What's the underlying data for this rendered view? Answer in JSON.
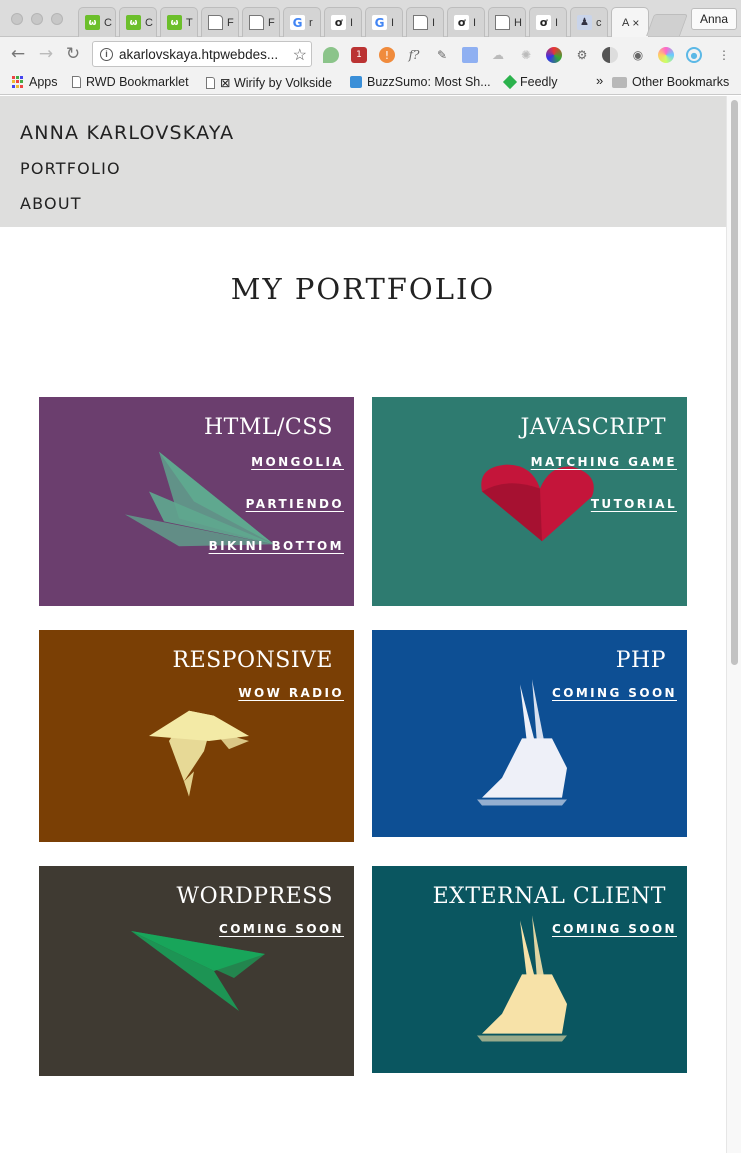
{
  "browser": {
    "tabs": [
      {
        "title": "C",
        "icon": "green"
      },
      {
        "title": "C",
        "icon": "green"
      },
      {
        "title": "T",
        "icon": "green"
      },
      {
        "title": "F",
        "icon": "doc"
      },
      {
        "title": "F",
        "icon": "doc"
      },
      {
        "title": "r",
        "icon": "goog"
      },
      {
        "title": "I",
        "icon": "cp"
      },
      {
        "title": "I",
        "icon": "goog"
      },
      {
        "title": "I",
        "icon": "doc"
      },
      {
        "title": "I",
        "icon": "cp"
      },
      {
        "title": "H",
        "icon": "doc"
      },
      {
        "title": "I",
        "icon": "cp"
      },
      {
        "title": "c",
        "icon": "user"
      },
      {
        "title": "A",
        "icon": "none"
      }
    ],
    "profile_name": "Anna",
    "url": "akarlovskaya.htpwebdes...",
    "bookmarks": {
      "apps": "Apps",
      "rwd": "RWD Bookmarklet",
      "wirify": "⊠ Wirify by Volkside",
      "buzzsumo": "BuzzSumo: Most Sh...",
      "feedly": "Feedly",
      "overflow": "»",
      "other": "Other Bookmarks"
    }
  },
  "site": {
    "name": "ANNA KARLOVSKAYA",
    "nav": [
      "PORTFOLIO",
      "ABOUT"
    ],
    "page_title": "MY PORTFOLIO"
  },
  "cards": [
    {
      "title": "HTML/CSS",
      "links": [
        "MONGOLIA",
        "PARTIENDO",
        "BIKINI BOTTOM"
      ],
      "bg": "#6b3e6e",
      "art": "plane",
      "art_color": "#5fa88f"
    },
    {
      "title": "JAVASCRIPT",
      "links": [
        "MATCHING GAME",
        "TUTORIAL"
      ],
      "bg": "#2e7b70",
      "art": "heart",
      "art_color": "#c4153a"
    },
    {
      "title": "RESPONSIVE",
      "links": [
        "WOW RADIO"
      ],
      "bg": "#7a3f05",
      "art": "bird",
      "art_color": "#f3eaa6"
    },
    {
      "title": "PHP",
      "links": [
        "COMING SOON"
      ],
      "bg": "#0d4f94",
      "art": "rabbit",
      "art_color": "#eef0f8"
    },
    {
      "title": "WORDPRESS",
      "links": [
        "COMING SOON"
      ],
      "bg": "#3f3a32",
      "art": "plane2",
      "art_color": "#18a55a"
    },
    {
      "title": "EXTERNAL CLIENT",
      "links": [
        "COMING SOON"
      ],
      "bg": "#0a5660",
      "art": "rabbit",
      "art_color": "#f7e2a8"
    }
  ]
}
